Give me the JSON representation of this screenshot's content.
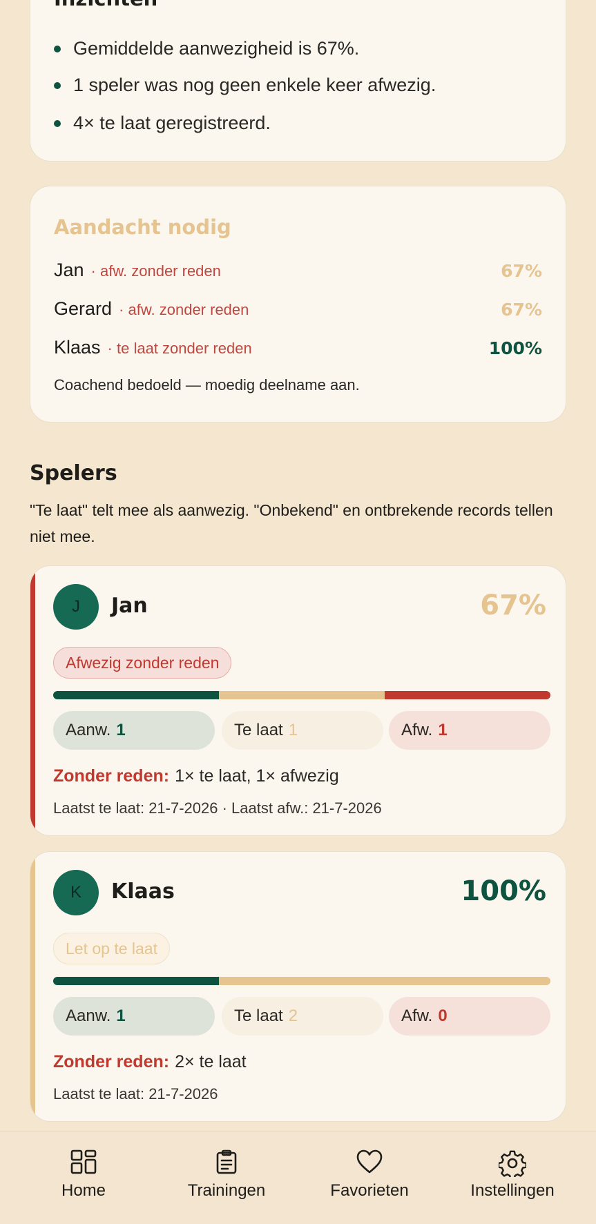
{
  "insights": {
    "title": "Inzichten",
    "items": [
      "Gemiddelde aanwezigheid is 67%.",
      "1 speler was nog geen enkele keer afwezig.",
      "4× te laat geregistreerd."
    ]
  },
  "attention": {
    "title": "Aandacht nodig",
    "rows": [
      {
        "name": "Jan",
        "reason": "· afw. zonder reden",
        "percent": "67%",
        "color": "#e5c48f"
      },
      {
        "name": "Gerard",
        "reason": "· afw. zonder reden",
        "percent": "67%",
        "color": "#e5c48f"
      },
      {
        "name": "Klaas",
        "reason": "· te laat zonder reden",
        "percent": "100%",
        "color": "#0e5340"
      }
    ],
    "note": "Coachend bedoeld — moedig deelname aan."
  },
  "players_section": {
    "title": "Spelers",
    "subtitle": "\"Te laat\" telt mee als aanwezig. \"Onbekend\" en ontbrekende records tellen niet mee."
  },
  "players": [
    {
      "initial": "J",
      "name": "Jan",
      "percent": "67%",
      "percent_color": "#e5c48f",
      "edge_color": "#c0392f",
      "badge": "Afwezig zonder reden",
      "counts": {
        "present_label": "Aanw.",
        "present": "1",
        "late_label": "Te laat",
        "late": "1",
        "absent_label": "Afw.",
        "absent": "1"
      },
      "bar_fractions": {
        "present": 0.333,
        "late": 0.333,
        "absent": 0.334
      },
      "without_reason_label": "Zonder reden:",
      "without_reason": "1× te laat, 1× afwezig",
      "last": "Laatst te laat: 21-7-2026 · Laatst afw.: 21-7-2026"
    },
    {
      "initial": "K",
      "name": "Klaas",
      "percent": "100%",
      "percent_color": "#0e5340",
      "edge_color": "#e5c48f",
      "badge": "Let op te laat",
      "counts": {
        "present_label": "Aanw.",
        "present": "1",
        "late_label": "Te laat",
        "late": "2",
        "absent_label": "Afw.",
        "absent": "0"
      },
      "bar_fractions": {
        "present": 0.333,
        "late": 0.667,
        "absent": 0
      },
      "without_reason_label": "Zonder reden:",
      "without_reason": "2× te laat",
      "last": "Laatst te laat: 21-7-2026"
    }
  ],
  "nav": [
    {
      "label": "Home",
      "icon": "home-grid-icon"
    },
    {
      "label": "Trainingen",
      "icon": "clipboard-icon"
    },
    {
      "label": "Favorieten",
      "icon": "heart-icon"
    },
    {
      "label": "Instellingen",
      "icon": "gear-icon"
    }
  ],
  "colors": {
    "accent_green": "#0e5340",
    "warning_sand": "#e5c48f",
    "danger_red": "#c0392f",
    "background": "#f4e6cf"
  }
}
